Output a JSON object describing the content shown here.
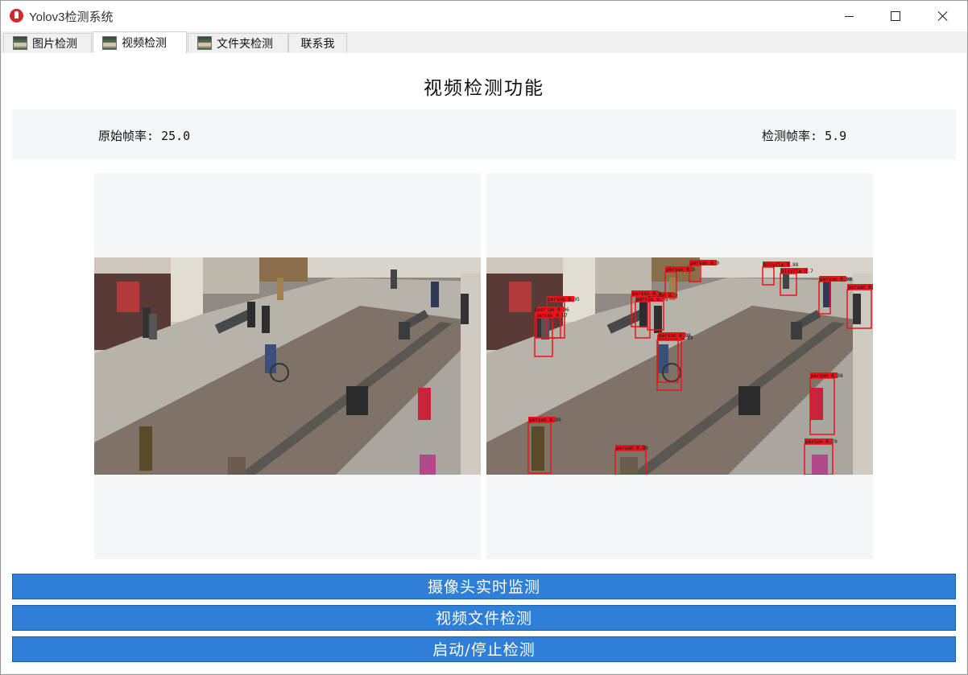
{
  "window": {
    "title": "Yolov3检测系统",
    "controls": [
      "minimize-icon",
      "maximize-icon",
      "close-icon"
    ]
  },
  "tabs": [
    {
      "label": "图片检测",
      "icon": "image-thumbnail-icon",
      "active": false
    },
    {
      "label": "视频检测",
      "icon": "image-thumbnail-icon",
      "active": true
    },
    {
      "label": "文件夹检测",
      "icon": "image-thumbnail-icon",
      "active": false
    },
    {
      "label": "联系我",
      "icon": "",
      "active": false
    }
  ],
  "main": {
    "heading": "视频检测功能",
    "fps": {
      "original_label": "原始帧率:",
      "original_value": "25.0",
      "detect_label": "检测帧率:",
      "detect_value": "5.9"
    },
    "frames": {
      "original": "street scene video frame",
      "detected_boxes": [
        {
          "label": "person 0.99"
        },
        {
          "label": "person 0.99"
        },
        {
          "label": "person 0.98"
        },
        {
          "label": "person 0.97"
        },
        {
          "label": "person 0.96"
        },
        {
          "label": "person 0.95"
        },
        {
          "label": "person 0.95"
        },
        {
          "label": "bicycle 0.89"
        },
        {
          "label": "person 0.98"
        },
        {
          "label": "person 0.70"
        },
        {
          "label": "person 0.99"
        },
        {
          "label": "person 0.9"
        },
        {
          "label": "person 0.9"
        },
        {
          "label": "bicycle 0.88"
        },
        {
          "label": "bicycle 0.7"
        },
        {
          "label": "person 0.98"
        },
        {
          "label": "person 0.9"
        },
        {
          "label": "person 0.9"
        }
      ]
    },
    "buttons": {
      "camera": "摄像头实时监测",
      "video_file": "视频文件检测",
      "start_stop": "启动/停止检测"
    }
  },
  "colors": {
    "button": "#2f7fd6",
    "panel": "#f5f6f8",
    "box": "#e8141c"
  }
}
